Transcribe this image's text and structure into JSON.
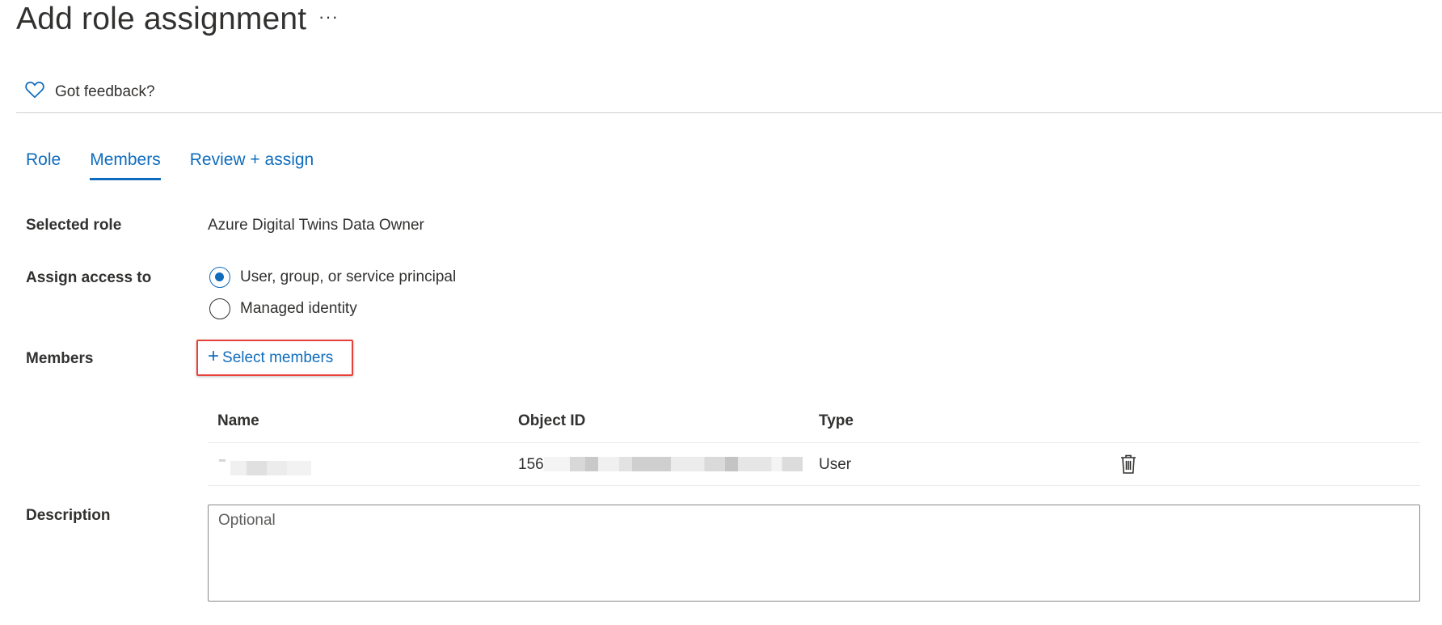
{
  "header": {
    "title": "Add role assignment",
    "more_label": "···"
  },
  "feedback": {
    "label": "Got feedback?",
    "icon": "heart-icon"
  },
  "tabs": [
    {
      "label": "Role",
      "active": false
    },
    {
      "label": "Members",
      "active": true
    },
    {
      "label": "Review + assign",
      "active": false
    }
  ],
  "form": {
    "selected_role_label": "Selected role",
    "selected_role_value": "Azure Digital Twins Data Owner",
    "assign_access_label": "Assign access to",
    "radio_options": [
      {
        "label": "User, group, or service principal",
        "checked": true
      },
      {
        "label": "Managed identity",
        "checked": false
      }
    ],
    "members_label": "Members",
    "select_members_label": "Select members",
    "description_label": "Description",
    "description_placeholder": "Optional"
  },
  "members_table": {
    "columns": [
      "Name",
      "Object ID",
      "Type"
    ],
    "rows": [
      {
        "name": "",
        "object_id": "156",
        "type": "User"
      }
    ]
  },
  "colors": {
    "accent": "#0f6cbd",
    "highlight_border": "#e8413a"
  }
}
